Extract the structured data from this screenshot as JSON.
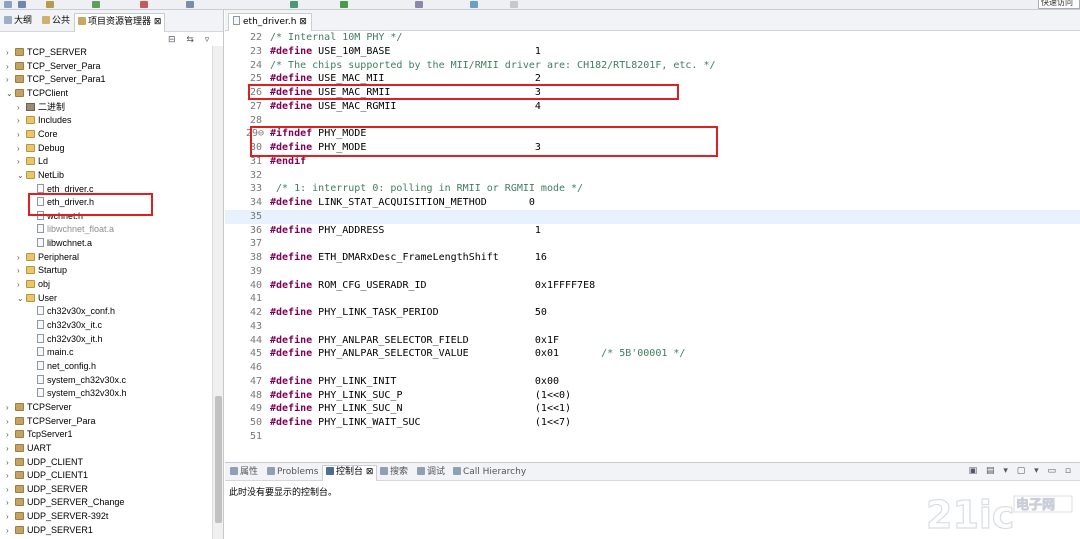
{
  "toolbar": {
    "quick_access": "快速访问"
  },
  "left_panel": {
    "tabs": [
      {
        "label": "大纲"
      },
      {
        "label": "公共"
      },
      {
        "label": "项目资源管理器 ⊠"
      }
    ],
    "tree_tools": "⊟ ⇆ ▿",
    "tree": [
      {
        "label": "TCP_SERVER",
        "depth": 0,
        "arrow": "›",
        "icon": "prj"
      },
      {
        "label": "TCP_Server_Para",
        "depth": 0,
        "arrow": "›",
        "icon": "prj"
      },
      {
        "label": "TCP_Server_Para1",
        "depth": 0,
        "arrow": "›",
        "icon": "prj"
      },
      {
        "label": "TCPClient",
        "depth": 0,
        "arrow": "⌄",
        "icon": "prj"
      },
      {
        "label": "二进制",
        "depth": 1,
        "arrow": "›",
        "icon": "bin"
      },
      {
        "label": "Includes",
        "depth": 1,
        "arrow": "›",
        "icon": "fld"
      },
      {
        "label": "Core",
        "depth": 1,
        "arrow": "›",
        "icon": "fld"
      },
      {
        "label": "Debug",
        "depth": 1,
        "arrow": "›",
        "icon": "fld"
      },
      {
        "label": "Ld",
        "depth": 1,
        "arrow": "›",
        "icon": "fld"
      },
      {
        "label": "NetLib",
        "depth": 1,
        "arrow": "⌄",
        "icon": "fld"
      },
      {
        "label": "eth_driver.c",
        "depth": 2,
        "arrow": "",
        "icon": "fil"
      },
      {
        "label": "eth_driver.h",
        "depth": 2,
        "arrow": "",
        "icon": "fil"
      },
      {
        "label": "wchnet.h",
        "depth": 2,
        "arrow": "",
        "icon": "fil"
      },
      {
        "label": "libwchnet_float.a",
        "depth": 2,
        "arrow": "",
        "icon": "fil",
        "dim": true
      },
      {
        "label": "libwchnet.a",
        "depth": 2,
        "arrow": "",
        "icon": "fil"
      },
      {
        "label": "Peripheral",
        "depth": 1,
        "arrow": "›",
        "icon": "fld"
      },
      {
        "label": "Startup",
        "depth": 1,
        "arrow": "›",
        "icon": "fld"
      },
      {
        "label": "obj",
        "depth": 1,
        "arrow": "›",
        "icon": "fld"
      },
      {
        "label": "User",
        "depth": 1,
        "arrow": "⌄",
        "icon": "fld"
      },
      {
        "label": "ch32v30x_conf.h",
        "depth": 2,
        "arrow": "",
        "icon": "fil"
      },
      {
        "label": "ch32v30x_it.c",
        "depth": 2,
        "arrow": "",
        "icon": "fil"
      },
      {
        "label": "ch32v30x_it.h",
        "depth": 2,
        "arrow": "",
        "icon": "fil"
      },
      {
        "label": "main.c",
        "depth": 2,
        "arrow": "",
        "icon": "fil"
      },
      {
        "label": "net_config.h",
        "depth": 2,
        "arrow": "",
        "icon": "fil"
      },
      {
        "label": "system_ch32v30x.c",
        "depth": 2,
        "arrow": "",
        "icon": "fil"
      },
      {
        "label": "system_ch32v30x.h",
        "depth": 2,
        "arrow": "",
        "icon": "fil"
      },
      {
        "label": "TCPServer",
        "depth": 0,
        "arrow": "›",
        "icon": "prj"
      },
      {
        "label": "TCPServer_Para",
        "depth": 0,
        "arrow": "›",
        "icon": "prj"
      },
      {
        "label": "TcpServer1",
        "depth": 0,
        "arrow": "›",
        "icon": "prj"
      },
      {
        "label": "UART",
        "depth": 0,
        "arrow": "›",
        "icon": "prj"
      },
      {
        "label": "UDP_CLIENT",
        "depth": 0,
        "arrow": "›",
        "icon": "prj"
      },
      {
        "label": "UDP_CLIENT1",
        "depth": 0,
        "arrow": "›",
        "icon": "prj"
      },
      {
        "label": "UDP_SERVER",
        "depth": 0,
        "arrow": "›",
        "icon": "prj"
      },
      {
        "label": "UDP_SERVER_Change",
        "depth": 0,
        "arrow": "›",
        "icon": "prj"
      },
      {
        "label": "UDP_SERVER-392t",
        "depth": 0,
        "arrow": "›",
        "icon": "prj"
      },
      {
        "label": "UDP_SERVER1",
        "depth": 0,
        "arrow": "›",
        "icon": "prj"
      }
    ]
  },
  "editor": {
    "tab": "eth_driver.h ⊠",
    "lines": [
      {
        "n": "22",
        "text": "/* Internal 10M PHY */",
        "kind": "comment"
      },
      {
        "n": "23",
        "kw": "#define",
        "text": " USE_10M_BASE                        1"
      },
      {
        "n": "24",
        "text": "/* The chips supported by the MII/RMII driver are: CH182/RTL8201F, etc. */",
        "kind": "comment"
      },
      {
        "n": "25",
        "kw": "#define",
        "text": " USE_MAC_MII                         2"
      },
      {
        "n": "26",
        "kw": "#define",
        "text": " USE_MAC_RMII                        3"
      },
      {
        "n": "27",
        "kw": "#define",
        "text": " USE_MAC_RGMII                       4"
      },
      {
        "n": "28",
        "text": ""
      },
      {
        "n": "29⊖",
        "kw": "#ifndef",
        "text": " PHY_MODE"
      },
      {
        "n": "30",
        "kw": "#define",
        "text": " PHY_MODE                            3"
      },
      {
        "n": "31",
        "kw": "#endif",
        "text": ""
      },
      {
        "n": "32",
        "text": ""
      },
      {
        "n": "33",
        "text": " /* 1: interrupt 0: polling in RMII or RGMII mode */",
        "kind": "comment"
      },
      {
        "n": "34",
        "kw": "#define",
        "text": " LINK_STAT_ACQUISITION_METHOD       0"
      },
      {
        "n": "35",
        "text": "",
        "highlight": true
      },
      {
        "n": "36",
        "kw": "#define",
        "text": " PHY_ADDRESS                         1"
      },
      {
        "n": "37",
        "text": ""
      },
      {
        "n": "38",
        "kw": "#define",
        "text": " ETH_DMARxDesc_FrameLengthShift      16"
      },
      {
        "n": "39",
        "text": ""
      },
      {
        "n": "40",
        "kw": "#define",
        "text": " ROM_CFG_USERADR_ID                  0x1FFFF7E8"
      },
      {
        "n": "41",
        "text": ""
      },
      {
        "n": "42",
        "kw": "#define",
        "text": " PHY_LINK_TASK_PERIOD                50"
      },
      {
        "n": "43",
        "text": ""
      },
      {
        "n": "44",
        "kw": "#define",
        "text": " PHY_ANLPAR_SELECTOR_FIELD           0x1F"
      },
      {
        "n": "45",
        "kw": "#define",
        "text": " PHY_ANLPAR_SELECTOR_VALUE           0x01       ",
        "tail_comment": "/* 5B'00001 */"
      },
      {
        "n": "46",
        "text": ""
      },
      {
        "n": "47",
        "kw": "#define",
        "text": " PHY_LINK_INIT                       0x00"
      },
      {
        "n": "48",
        "kw": "#define",
        "text": " PHY_LINK_SUC_P                      (1<<0)"
      },
      {
        "n": "49",
        "kw": "#define",
        "text": " PHY_LINK_SUC_N                      (1<<1)"
      },
      {
        "n": "50",
        "kw": "#define",
        "text": " PHY_LINK_WAIT_SUC                   (1<<7)"
      },
      {
        "n": "51",
        "text": ""
      }
    ]
  },
  "console": {
    "tabs": [
      {
        "label": "属性"
      },
      {
        "label": "Problems"
      },
      {
        "label": "控制台 ⊠"
      },
      {
        "label": "搜索"
      },
      {
        "label": "调试"
      },
      {
        "label": "Call Hierarchy"
      }
    ],
    "message": "此时没有要显示的控制台。",
    "tools": "▣ ▤ ▾ ▢ ▾ ▭ ▫"
  },
  "watermark": {
    "brand": "21ic",
    "site": "电子网"
  },
  "colors": {
    "highlight_box": "#e02020",
    "keyword": "#7f0055",
    "comment": "#3f7f5f"
  }
}
